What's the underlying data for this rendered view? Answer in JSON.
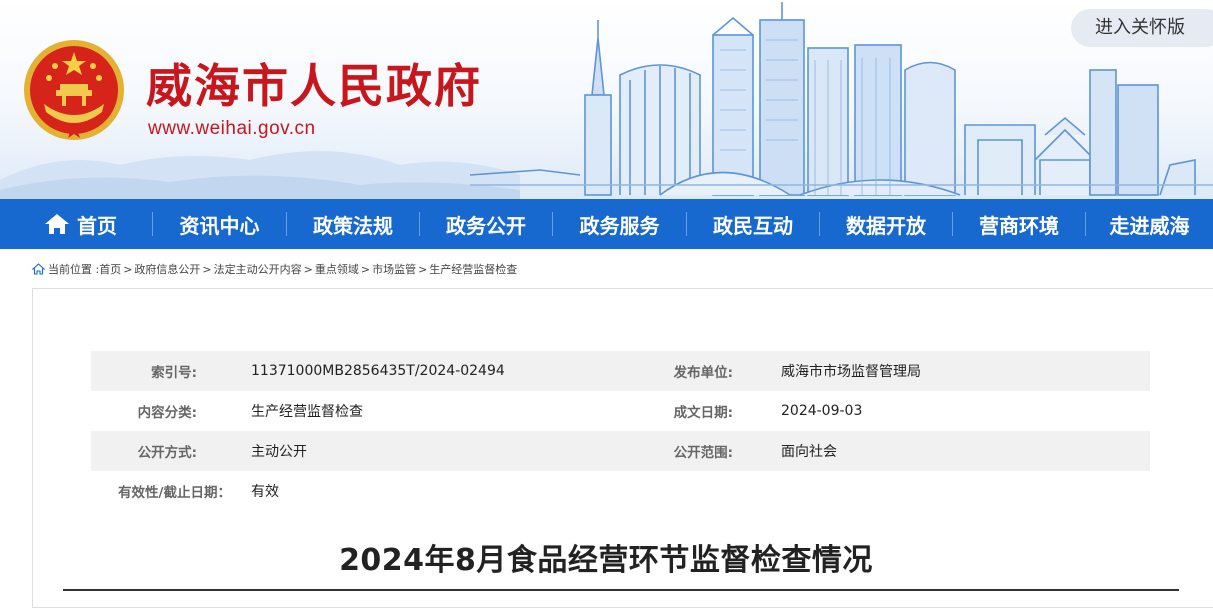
{
  "header": {
    "site_title": "威海市人民政府",
    "site_url": "www.weihai.gov.cn",
    "care_mode_button": "进入关怀版",
    "emblem_icon": "national-emblem-icon",
    "brand_color": "#c8161d"
  },
  "nav": {
    "bg_color": "#1769cf",
    "home_icon": "home-icon",
    "items": [
      {
        "label": "首页"
      },
      {
        "label": "资讯中心"
      },
      {
        "label": "政策法规"
      },
      {
        "label": "政务公开"
      },
      {
        "label": "政务服务"
      },
      {
        "label": "政民互动"
      },
      {
        "label": "数据开放"
      },
      {
        "label": "营商环境"
      },
      {
        "label": "走进威海"
      }
    ]
  },
  "breadcrumb": {
    "icon": "home-icon",
    "prefix": "当前位置 :",
    "items": [
      "首页",
      "政府信息公开",
      "法定主动公开内容",
      "重点领域",
      "市场监管",
      "生产经营监督检查"
    ],
    "separator": ">"
  },
  "meta": {
    "index_label": "索引号:",
    "index_value": "11371000MB2856435T/2024-02494",
    "publisher_label": "发布单位:",
    "publisher_value": "威海市市场监督管理局",
    "category_label": "内容分类:",
    "category_value": "生产经营监督检查",
    "date_label": "成文日期:",
    "date_value": "2024-09-03",
    "method_label": "公开方式:",
    "method_value": "主动公开",
    "scope_label": "公开范围:",
    "scope_value": "面向社会",
    "validity_label": "有效性/截止日期：",
    "validity_value": "有效"
  },
  "article": {
    "title": "2024年8月食品经营环节监督检查情况"
  }
}
